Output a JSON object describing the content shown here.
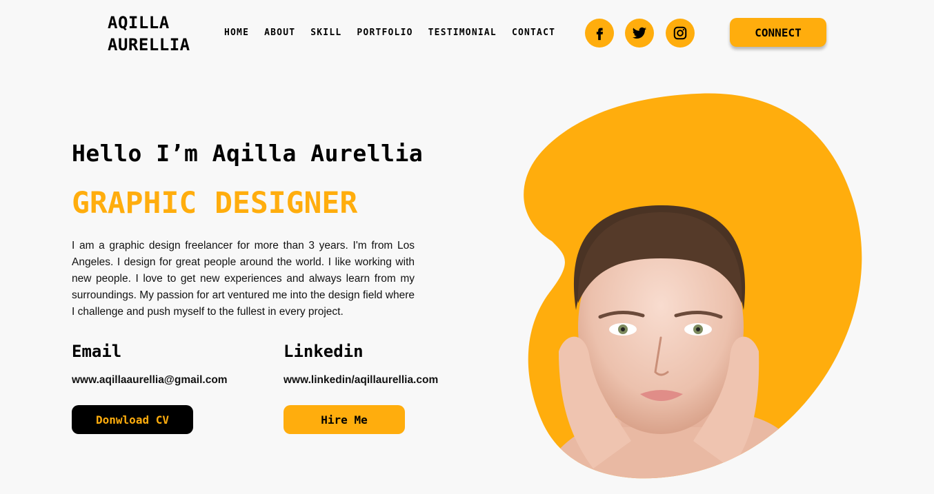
{
  "brand": {
    "line1": "AQILLA",
    "line2": "AURELLIA"
  },
  "nav": {
    "items": [
      "HOME",
      "ABOUT",
      "SKILL",
      "PORTFOLIO",
      "TESTIMONIAL",
      "CONTACT"
    ]
  },
  "social": {
    "icons": [
      "facebook-icon",
      "twitter-icon",
      "instagram-icon"
    ]
  },
  "header": {
    "connect_label": "CONNECT"
  },
  "hero": {
    "greeting": "Hello I’m Aqilla Aurellia",
    "role": "GRAPHIC DESIGNER",
    "bio": "I am a graphic design freelancer for more than 3 years. I'm from Los Angeles. I design for great people around the world. I like working with new people. I love to get new experiences and always learn from my surroundings. My passion for art ventured me into the design field where I challenge and push myself to the fullest in every project."
  },
  "contact": {
    "email_label": "Email",
    "email_value": "www.aqillaaurellia@gmail.com",
    "linkedin_label": "Linkedin",
    "linkedin_value": "www.linkedin/aqillaurellia.com"
  },
  "buttons": {
    "download_cv": "Donwload CV",
    "hire_me": "Hire Me"
  },
  "colors": {
    "accent": "#ffad0d",
    "background": "#f8f8f8",
    "text": "#000000"
  }
}
